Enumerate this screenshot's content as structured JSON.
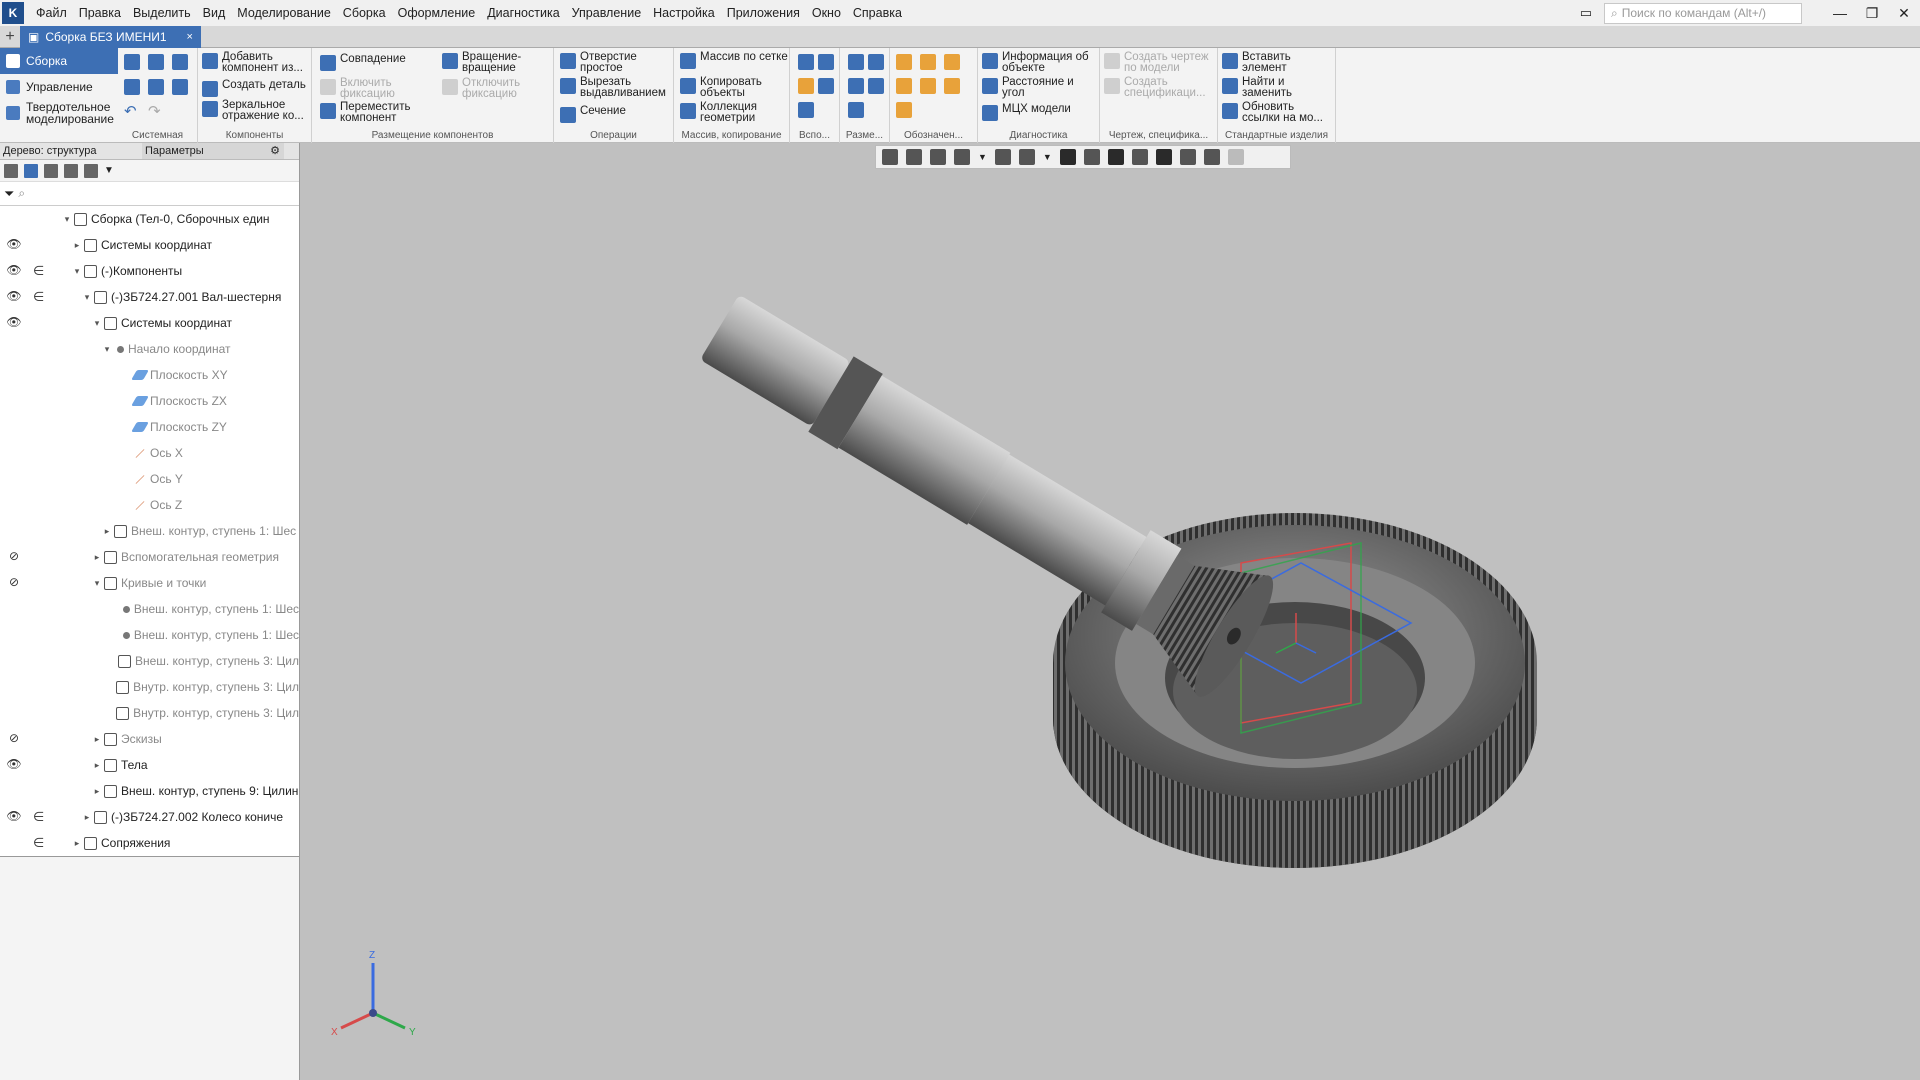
{
  "menubar": {
    "items": [
      "Файл",
      "Правка",
      "Выделить",
      "Вид",
      "Моделирование",
      "Сборка",
      "Оформление",
      "Диагностика",
      "Управление",
      "Настройка",
      "Приложения",
      "Окно",
      "Справка"
    ],
    "search_placeholder": "Поиск по командам (Alt+/)"
  },
  "tabs": {
    "plus": "+",
    "document": "Сборка БЕЗ ИМЕНИ1",
    "close": "×"
  },
  "modes": [
    "Сборка",
    "Управление",
    "Твердотельное моделирование"
  ],
  "ribbon": {
    "system_label": "Системная",
    "components": {
      "label": "Компоненты",
      "add": "Добавить компонент из...",
      "create": "Создать деталь",
      "mirror": "Зеркальное отражение ко..."
    },
    "placement": {
      "label": "Размещение компонентов",
      "coincidence": "Совпадение",
      "enable_fix": "Включить фиксацию",
      "move": "Переместить компонент",
      "rotate": "Вращение-вращение",
      "disable_fix": "Отключить фиксацию"
    },
    "operations": {
      "label": "Операции",
      "hole": "Отверстие простое",
      "cut": "Вырезать выдавливанием",
      "section": "Сечение"
    },
    "array": {
      "label": "Массив, копирование",
      "grid": "Массив по сетке",
      "copy": "Копировать объекты",
      "collection": "Коллекция геометрии"
    },
    "aux_label": "Вспо...",
    "dim_label": "Разме...",
    "notation_label": "Обозначен...",
    "diagnostics": {
      "label": "Диагностика",
      "info": "Информация об объекте",
      "distance": "Расстояние и угол",
      "mass": "МЦХ модели"
    },
    "drawing": {
      "label": "Чертеж, специфика...",
      "create_drawing": "Создать чертеж по модели",
      "create_spec": "Создать спецификаци..."
    },
    "standard": {
      "label": "Стандартные изделия",
      "insert": "Вставить элемент",
      "find": "Найти и заменить",
      "update": "Обновить ссылки на мо..."
    }
  },
  "panel": {
    "tab1": "Дерево: структура",
    "tab2": "Параметры",
    "gear": "⚙"
  },
  "tree": [
    {
      "label": "Сборка (Тел-0, Сборочных един",
      "indent": 0,
      "arrow": "▾",
      "eye": "",
      "link": "",
      "grey": false,
      "icon": "box"
    },
    {
      "label": "Системы координат",
      "indent": 1,
      "arrow": "▸",
      "eye": "👁",
      "link": "",
      "grey": false,
      "icon": "box"
    },
    {
      "label": "(-)Компоненты",
      "indent": 1,
      "arrow": "▾",
      "eye": "👁",
      "link": "∈",
      "grey": false,
      "icon": "box"
    },
    {
      "label": "(-)ЗБ724.27.001 Вал-шестерня",
      "indent": 2,
      "arrow": "▾",
      "eye": "👁",
      "link": "∈",
      "grey": false,
      "icon": "box"
    },
    {
      "label": "Системы координат",
      "indent": 3,
      "arrow": "▾",
      "eye": "👁",
      "link": "",
      "grey": false,
      "icon": "box"
    },
    {
      "label": "Начало координат",
      "indent": 4,
      "arrow": "▾",
      "eye": "",
      "link": "",
      "grey": true,
      "icon": "dot"
    },
    {
      "label": "Плоскость XY",
      "indent": 6,
      "arrow": "",
      "eye": "",
      "link": "",
      "grey": true,
      "icon": "plane"
    },
    {
      "label": "Плоскость ZX",
      "indent": 6,
      "arrow": "",
      "eye": "",
      "link": "",
      "grey": true,
      "icon": "plane"
    },
    {
      "label": "Плоскость ZY",
      "indent": 6,
      "arrow": "",
      "eye": "",
      "link": "",
      "grey": true,
      "icon": "plane"
    },
    {
      "label": "Ось X",
      "indent": 6,
      "arrow": "",
      "eye": "",
      "link": "",
      "grey": true,
      "icon": "line"
    },
    {
      "label": "Ось Y",
      "indent": 6,
      "arrow": "",
      "eye": "",
      "link": "",
      "grey": true,
      "icon": "line"
    },
    {
      "label": "Ось Z",
      "indent": 6,
      "arrow": "",
      "eye": "",
      "link": "",
      "grey": true,
      "icon": "line"
    },
    {
      "label": "Внеш. контур, ступень 1: Шес",
      "indent": 4,
      "arrow": "▸",
      "eye": "",
      "link": "",
      "grey": true,
      "icon": "box"
    },
    {
      "label": "Вспомогательная геометрия",
      "indent": 3,
      "arrow": "▸",
      "eye": "⊘",
      "link": "",
      "grey": true,
      "icon": "box"
    },
    {
      "label": "Кривые и точки",
      "indent": 3,
      "arrow": "▾",
      "eye": "⊘",
      "link": "",
      "grey": true,
      "icon": "box"
    },
    {
      "label": "Внеш. контур, ступень 1: Шес",
      "indent": 5,
      "arrow": "",
      "eye": "",
      "link": "",
      "grey": true,
      "icon": "dot"
    },
    {
      "label": "Внеш. контур, ступень 1: Шес",
      "indent": 5,
      "arrow": "",
      "eye": "",
      "link": "",
      "grey": true,
      "icon": "dot"
    },
    {
      "label": "Внеш. контур, ступень 3: Цил",
      "indent": 5,
      "arrow": "",
      "eye": "",
      "link": "",
      "grey": true,
      "icon": "box"
    },
    {
      "label": "Внутр. контур, ступень 3: Цил",
      "indent": 5,
      "arrow": "",
      "eye": "",
      "link": "",
      "grey": true,
      "icon": "box"
    },
    {
      "label": "Внутр. контур, ступень 3: Цил",
      "indent": 5,
      "arrow": "",
      "eye": "",
      "link": "",
      "grey": true,
      "icon": "box"
    },
    {
      "label": "Эскизы",
      "indent": 3,
      "arrow": "▸",
      "eye": "⊘",
      "link": "",
      "grey": true,
      "icon": "box"
    },
    {
      "label": "Тела",
      "indent": 3,
      "arrow": "▸",
      "eye": "👁",
      "link": "",
      "grey": false,
      "icon": "box"
    },
    {
      "label": "Внеш. контур, ступень 9: Цилин",
      "indent": 3,
      "arrow": "▸",
      "eye": "",
      "link": "",
      "grey": false,
      "icon": "box"
    },
    {
      "label": "(-)ЗБ724.27.002 Колесо кониче",
      "indent": 2,
      "arrow": "▸",
      "eye": "👁",
      "link": "∈",
      "grey": false,
      "icon": "box"
    },
    {
      "label": "Сопряжения",
      "indent": 1,
      "arrow": "▸",
      "eye": "",
      "link": "∈",
      "grey": false,
      "icon": "box"
    }
  ],
  "axes": {
    "x": "X",
    "y": "Y",
    "z": "Z"
  },
  "colors": {
    "accent": "#3d6fb4",
    "viewport_bg": "#c0c0c0"
  }
}
